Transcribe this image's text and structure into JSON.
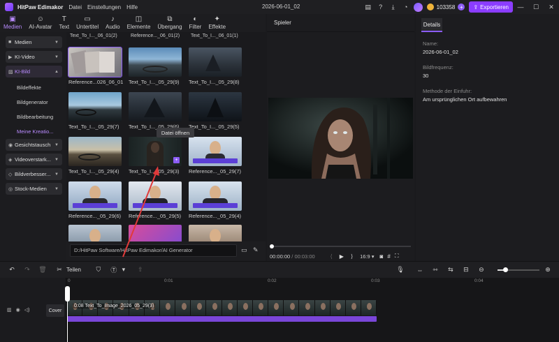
{
  "titlebar": {
    "app_title": "HitPaw Edimakor",
    "menu": [
      "Datei",
      "Einstellungen",
      "Hilfe"
    ],
    "doc_title": "2026-06-01_02",
    "coins": "103358",
    "export_label": "Exportieren"
  },
  "media_tabs": [
    {
      "label": "Medien",
      "icon": "media-icon"
    },
    {
      "label": "AI-Avatar",
      "icon": "avatar-icon"
    },
    {
      "label": "Text",
      "icon": "text-icon"
    },
    {
      "label": "Untertitel",
      "icon": "subtitle-icon"
    },
    {
      "label": "Audio",
      "icon": "audio-icon"
    },
    {
      "label": "Elemente",
      "icon": "elements-icon"
    },
    {
      "label": "Übergang",
      "icon": "transition-icon"
    },
    {
      "label": "Filter",
      "icon": "filter-icon"
    },
    {
      "label": "Effekte",
      "icon": "effects-icon"
    }
  ],
  "sidebar": {
    "medien": "Medien",
    "ki_video": "KI-Video",
    "ki_bild": "KI-Bild",
    "sub": [
      "Bildeffekte",
      "Bildgenerator",
      "Bildbearbeitung",
      "Meine Kreatio..."
    ],
    "gesicht": "Gesichtstausch",
    "videoverstark": "Videoverstark...",
    "bildverbesser": "Bildverbesser...",
    "stock": "Stock-Medien"
  },
  "grid": {
    "top_labels": [
      "Text_To_I..._06_01(2)",
      "Reference..._06_01(2)",
      "Text_To_I..._06_01(1)"
    ],
    "tiles": [
      {
        "label": "Reference...026_06_01"
      },
      {
        "label": "Text_To_I..._05_29(9)"
      },
      {
        "label": "Text_To_I..._05_29(8)"
      },
      {
        "label": "Text_To_I..._05_29(7)"
      },
      {
        "label": "Text_To_I..._05_29(6)"
      },
      {
        "label": "Text_To_I..._05_29(5)"
      },
      {
        "label": "Text_To_I..._05_29(4)"
      },
      {
        "label": "Text_To_I..._05_29(3)"
      },
      {
        "label": "Reference..._05_29(7)"
      },
      {
        "label": "Reference..._05_29(6)"
      },
      {
        "label": "Reference..._05_29(5)"
      },
      {
        "label": "Reference..._05_29(4)"
      }
    ],
    "tooltip": "Datei öffnen",
    "path": "D:/HitPaw Software/HitPaw Edimakor/AI Generator"
  },
  "player": {
    "title": "Spieler",
    "time_current": "00:00:00",
    "time_total": "/ 00:03:00",
    "ratio": "16:9"
  },
  "details": {
    "tab": "Details",
    "name_label": "Name:",
    "name_value": "2026-06-01_02",
    "fps_label": "Bildfrequenz:",
    "fps_value": "30",
    "import_label": "Methode der Einfuhr:",
    "import_value": "Am ursprünglichen Ort aufbewahren"
  },
  "timeline": {
    "split_label": "Teilen",
    "cover_label": "Cover",
    "clip_label": "0:08 Text_To_Image_2026_05_29(3)",
    "ruler": [
      "0",
      "0:01",
      "0:02",
      "0:03",
      "0:04"
    ]
  }
}
